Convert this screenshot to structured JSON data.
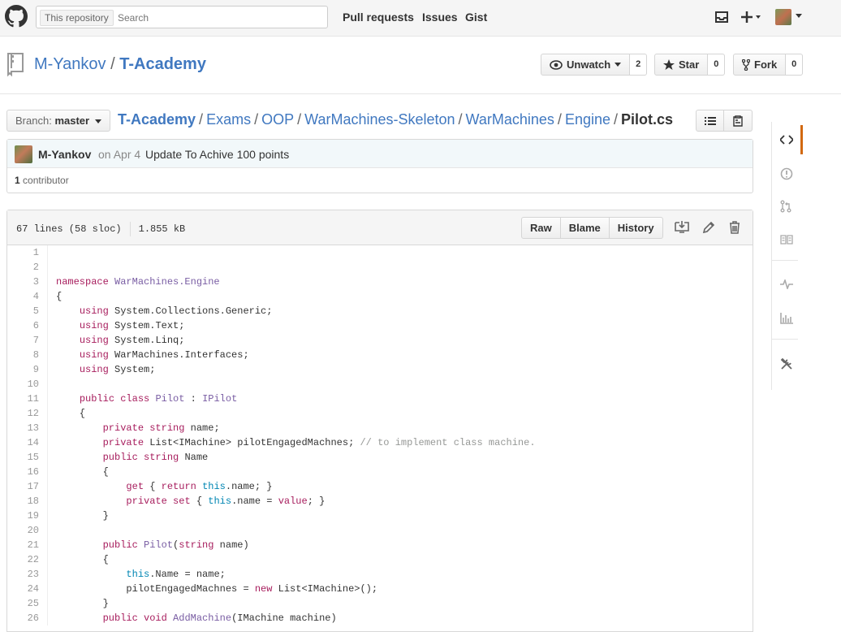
{
  "header": {
    "search_scope": "This repository",
    "search_placeholder": "Search",
    "nav": [
      "Pull requests",
      "Issues",
      "Gist"
    ],
    "icons": [
      "github-logo-icon",
      "inbox-icon",
      "plus-icon",
      "avatar-dropdown-icon"
    ]
  },
  "repo": {
    "owner": "M-Yankov",
    "separator": "/",
    "name": "T-Academy",
    "watch_label": "Unwatch",
    "watch_count": "2",
    "star_label": "Star",
    "star_count": "0",
    "fork_label": "Fork",
    "fork_count": "0"
  },
  "breadcrumb": {
    "branch_label": "Branch:",
    "branch_value": "master",
    "path": [
      "T-Academy",
      "Exams",
      "OOP",
      "WarMachines-Skeleton",
      "WarMachines",
      "Engine"
    ],
    "file": "Pilot.cs"
  },
  "commit": {
    "author": "M-Yankov",
    "date": "on Apr 4",
    "message": "Update To Achive 100 points",
    "contributors_count": "1",
    "contributors_label": "contributor"
  },
  "file": {
    "lines_info": "67 lines (58 sloc)",
    "size": "1.855 kB",
    "actions": [
      "Raw",
      "Blame",
      "History"
    ],
    "code": [
      [],
      [],
      [
        [
          "kw",
          "namespace"
        ],
        [
          "t",
          " "
        ],
        [
          "en",
          "WarMachines.Engine"
        ]
      ],
      [
        [
          "t",
          "{"
        ]
      ],
      [
        [
          "t",
          "    "
        ],
        [
          "kw",
          "using"
        ],
        [
          "t",
          " System.Collections.Generic;"
        ]
      ],
      [
        [
          "t",
          "    "
        ],
        [
          "kw",
          "using"
        ],
        [
          "t",
          " System.Text;"
        ]
      ],
      [
        [
          "t",
          "    "
        ],
        [
          "kw",
          "using"
        ],
        [
          "t",
          " System.Linq;"
        ]
      ],
      [
        [
          "t",
          "    "
        ],
        [
          "kw",
          "using"
        ],
        [
          "t",
          " WarMachines.Interfaces;"
        ]
      ],
      [
        [
          "t",
          "    "
        ],
        [
          "kw",
          "using"
        ],
        [
          "t",
          " System;"
        ]
      ],
      [],
      [
        [
          "t",
          "    "
        ],
        [
          "kw",
          "public"
        ],
        [
          "t",
          " "
        ],
        [
          "kw",
          "class"
        ],
        [
          "t",
          " "
        ],
        [
          "en",
          "Pilot"
        ],
        [
          "t",
          " : "
        ],
        [
          "en",
          "IPilot"
        ]
      ],
      [
        [
          "t",
          "    {"
        ]
      ],
      [
        [
          "t",
          "        "
        ],
        [
          "kw",
          "private"
        ],
        [
          "t",
          " "
        ],
        [
          "kw",
          "string"
        ],
        [
          "t",
          " name;"
        ]
      ],
      [
        [
          "t",
          "        "
        ],
        [
          "kw",
          "private"
        ],
        [
          "t",
          " List<IMachine> pilotEngagedMachnes; "
        ],
        [
          "cm",
          "// to implement class machine."
        ]
      ],
      [
        [
          "t",
          "        "
        ],
        [
          "kw",
          "public"
        ],
        [
          "t",
          " "
        ],
        [
          "kw",
          "string"
        ],
        [
          "t",
          " Name"
        ]
      ],
      [
        [
          "t",
          "        {"
        ]
      ],
      [
        [
          "t",
          "            "
        ],
        [
          "kw",
          "get"
        ],
        [
          "t",
          " { "
        ],
        [
          "kw",
          "return"
        ],
        [
          "t",
          " "
        ],
        [
          "cb",
          "this"
        ],
        [
          "t",
          ".name; }"
        ]
      ],
      [
        [
          "t",
          "            "
        ],
        [
          "kw",
          "private"
        ],
        [
          "t",
          " "
        ],
        [
          "kw",
          "set"
        ],
        [
          "t",
          " { "
        ],
        [
          "cb",
          "this"
        ],
        [
          "t",
          ".name = "
        ],
        [
          "kw",
          "value"
        ],
        [
          "t",
          "; }"
        ]
      ],
      [
        [
          "t",
          "        }"
        ]
      ],
      [],
      [
        [
          "t",
          "        "
        ],
        [
          "kw",
          "public"
        ],
        [
          "t",
          " "
        ],
        [
          "en",
          "Pilot"
        ],
        [
          "t",
          "("
        ],
        [
          "kw",
          "string"
        ],
        [
          "t",
          " name)"
        ]
      ],
      [
        [
          "t",
          "        {"
        ]
      ],
      [
        [
          "t",
          "            "
        ],
        [
          "cb",
          "this"
        ],
        [
          "t",
          ".Name = name;"
        ]
      ],
      [
        [
          "t",
          "            pilotEngagedMachnes = "
        ],
        [
          "kw",
          "new"
        ],
        [
          "t",
          " List<IMachine>();"
        ]
      ],
      [
        [
          "t",
          "        }"
        ]
      ],
      [
        [
          "t",
          "        "
        ],
        [
          "kw",
          "public"
        ],
        [
          "t",
          " "
        ],
        [
          "kw",
          "void"
        ],
        [
          "t",
          " "
        ],
        [
          "en",
          "AddMachine"
        ],
        [
          "t",
          "(IMachine machine)"
        ]
      ]
    ]
  },
  "colors": {
    "link": "#4078c0",
    "keyword": "#a71d5d",
    "entity": "#795da3",
    "constant": "#0086b3",
    "comment": "#969896",
    "sidenav_active": "#d26911"
  }
}
